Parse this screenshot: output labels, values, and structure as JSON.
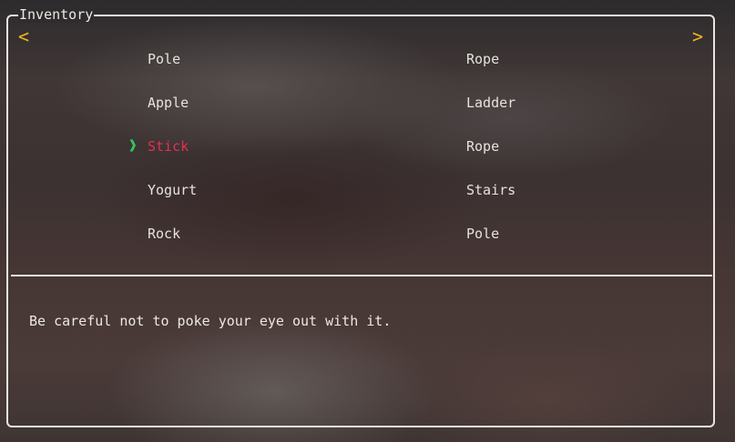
{
  "panel": {
    "title": "Inventory",
    "prev_arrow": "<",
    "next_arrow": ">"
  },
  "inventory": {
    "left_column": [
      "Pole",
      "Apple",
      "Stick",
      "Yogurt",
      "Rock"
    ],
    "right_column": [
      "Rope",
      "Ladder",
      "Rope",
      "Stairs",
      "Pole"
    ],
    "selected_item": "Stick",
    "selection_cursor": "❱"
  },
  "description": {
    "text": "Be careful not to poke your eye out with it."
  },
  "colors": {
    "accent_arrow": "#f2b61c",
    "selected_text": "#e0324e",
    "cursor": "#34c45a",
    "border": "#e8e4de",
    "text": "#e6e2dc"
  },
  "icons": {
    "prev": "left-chevron-icon",
    "next": "right-chevron-icon",
    "cursor": "selection-cursor-icon"
  }
}
